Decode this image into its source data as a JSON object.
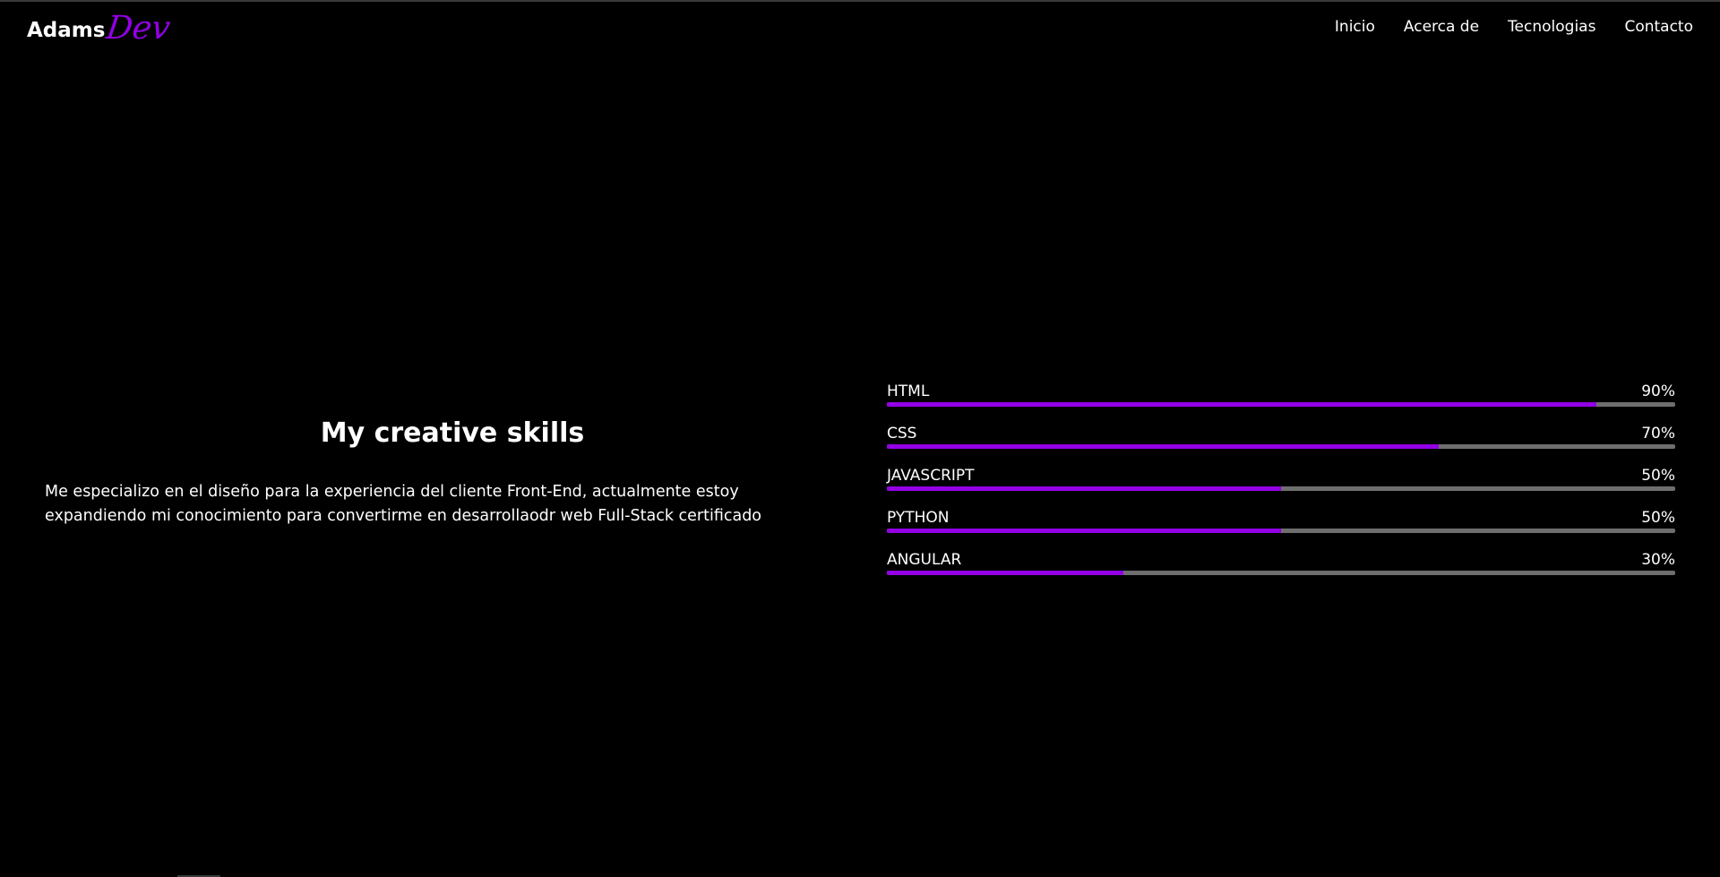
{
  "header": {
    "logo_main": "Adams",
    "logo_accent": "Dev",
    "nav": [
      {
        "label": "Inicio"
      },
      {
        "label": "Acerca de"
      },
      {
        "label": "Tecnologias"
      },
      {
        "label": "Contacto"
      }
    ]
  },
  "main": {
    "title": "My creative skills",
    "description": "Me especializo en el diseño para la experiencia del cliente Front-End, actualmente estoy expandiendo mi conocimiento para convertirme en desarrollaodr web Full-Stack certificado",
    "skills": [
      {
        "name": "HTML",
        "percent_label": "90%",
        "value": 90
      },
      {
        "name": "CSS",
        "percent_label": "70%",
        "value": 70
      },
      {
        "name": "JAVASCRIPT",
        "percent_label": "50%",
        "value": 50
      },
      {
        "name": "PYTHON",
        "percent_label": "50%",
        "value": 50
      },
      {
        "name": "ANGULAR",
        "percent_label": "30%",
        "value": 30
      }
    ]
  },
  "colors": {
    "background": "#000000",
    "text": "#ffffff",
    "accent": "#9400e6",
    "track": "#6e6e6e"
  }
}
